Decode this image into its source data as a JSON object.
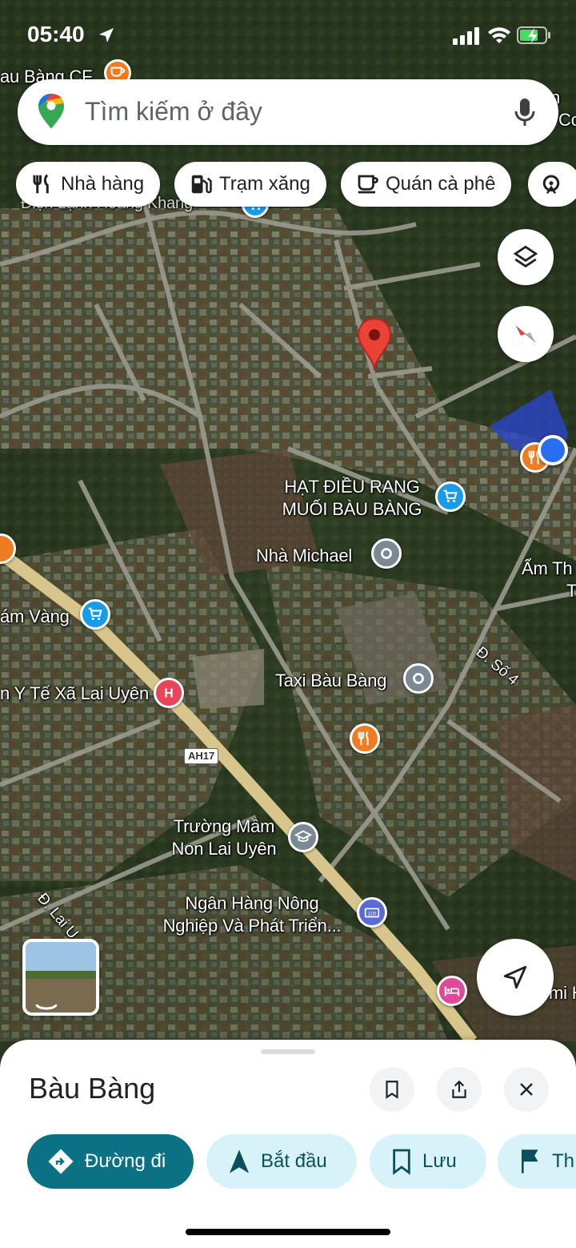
{
  "status_bar": {
    "time": "05:40",
    "icons": [
      "location-arrow-icon",
      "signal-icon",
      "wifi-icon",
      "battery-charging-icon"
    ]
  },
  "search": {
    "placeholder": "Tìm kiếm ở đây",
    "logo": "google-maps-pin-icon",
    "mic": "microphone-icon"
  },
  "chips": [
    {
      "label": "Nhà hàng",
      "icon": "restaurant-icon"
    },
    {
      "label": "Trạm xăng",
      "icon": "gas-station-icon"
    },
    {
      "label": "Quán cà phê",
      "icon": "coffee-icon"
    },
    {
      "label": "",
      "icon": "attractions-icon"
    }
  ],
  "map": {
    "labels": {
      "top_left": "au Bàng CF",
      "top_left2": "Điện Lạnh Hoàng Khang",
      "top_right": "ân",
      "top_right2": "Cc",
      "hat_dieu_1": "HẠT ĐIỀU RANG",
      "hat_dieu_2": "MUỐI BÀU BÀNG",
      "nha_michael": "Nhà Michael",
      "am_thuc_1": "Ẩm Th",
      "am_thuc_2": "T",
      "am_vang": "ám Vàng",
      "y_te": "n Y Tế Xã Lai Uyên",
      "taxi": "Taxi Bàu Bàng",
      "duong_so_4": "Đ. Số 4",
      "ah17": "AH17",
      "truong_1": "Trường Mầm",
      "truong_2": "Non Lai Uyên",
      "ngan_hang_1": "Ngân Hàng Nông",
      "ngan_hang_2": "Nghiệp Và Phát Triển...",
      "duong_lai": "Đ. Lai U",
      "mi_h": "mi H"
    },
    "layers_icon": "layers-icon",
    "compass_icon": "compass-icon",
    "my_location_icon": "navigation-arrow-icon"
  },
  "sheet": {
    "title": "Bàu Bàng",
    "actions": [
      {
        "label": "Đường đi",
        "icon": "directions-icon",
        "primary": true
      },
      {
        "label": "Bắt đầu",
        "icon": "navigation-icon",
        "primary": false
      },
      {
        "label": "Lưu",
        "icon": "bookmark-icon",
        "primary": false
      },
      {
        "label": "Th",
        "icon": "flag-icon",
        "primary": false
      }
    ]
  },
  "colors": {
    "primary": "#0b7285",
    "chip_light": "#d7f3f9",
    "pin_red": "#ea4335",
    "orange_pin": "#f07c22",
    "blue_pin": "#1a9be8",
    "grey_pin": "#7b8a92"
  }
}
